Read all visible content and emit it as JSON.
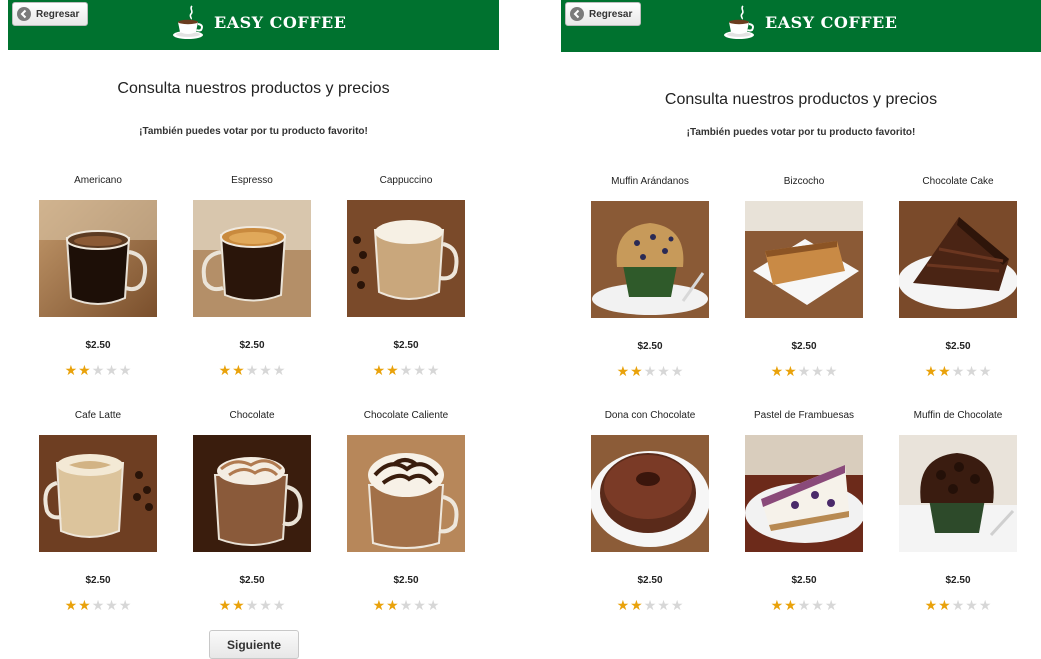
{
  "colors": {
    "header_bg": "#00722f",
    "star_on": "#e9a20b",
    "star_off": "#d7d7d7"
  },
  "screens": [
    {
      "header": {
        "back_label": "Regresar",
        "brand": "EASY COFFEE"
      },
      "title": "Consulta nuestros productos y precios",
      "subtitle": "¡También puedes votar por tu producto favorito!",
      "products": [
        {
          "name": "Americano",
          "price": "$2.50",
          "rating": 2,
          "max_rating": 5
        },
        {
          "name": "Espresso",
          "price": "$2.50",
          "rating": 2,
          "max_rating": 5
        },
        {
          "name": "Cappuccino",
          "price": "$2.50",
          "rating": 2,
          "max_rating": 5
        },
        {
          "name": "Cafe Latte",
          "price": "$2.50",
          "rating": 2,
          "max_rating": 5
        },
        {
          "name": "Chocolate",
          "price": "$2.50",
          "rating": 2,
          "max_rating": 5
        },
        {
          "name": "Chocolate Caliente",
          "price": "$2.50",
          "rating": 2,
          "max_rating": 5
        }
      ],
      "next_label": "Siguiente"
    },
    {
      "header": {
        "back_label": "Regresar",
        "brand": "EASY COFFEE"
      },
      "title": "Consulta nuestros productos y precios",
      "subtitle": "¡También puedes votar por tu producto favorito!",
      "products": [
        {
          "name": "Muffin Arándanos",
          "price": "$2.50",
          "rating": 2,
          "max_rating": 5
        },
        {
          "name": "Bizcocho",
          "price": "$2.50",
          "rating": 2,
          "max_rating": 5
        },
        {
          "name": "Chocolate Cake",
          "price": "$2.50",
          "rating": 2,
          "max_rating": 5
        },
        {
          "name": "Dona con Chocolate",
          "price": "$2.50",
          "rating": 2,
          "max_rating": 5
        },
        {
          "name": "Pastel de Frambuesas",
          "price": "$2.50",
          "rating": 2,
          "max_rating": 5
        },
        {
          "name": "Muffin de Chocolate",
          "price": "$2.50",
          "rating": 2,
          "max_rating": 5
        }
      ]
    }
  ]
}
